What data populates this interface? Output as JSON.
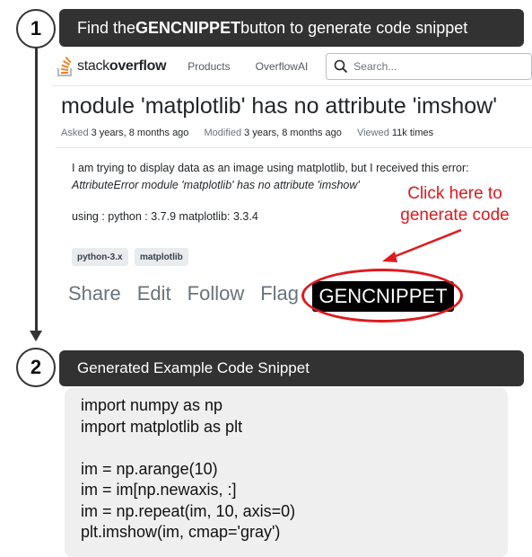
{
  "steps": {
    "one": "1",
    "two": "2"
  },
  "banner1": {
    "prefix": "Find the ",
    "bold": "GENCNIPPET",
    "suffix": " button to generate code snippet"
  },
  "banner2": {
    "title": "Generated Example Code Snippet"
  },
  "header": {
    "logo_light": "stack",
    "logo_bold": "overflow",
    "nav": [
      "Products",
      "OverflowAI"
    ],
    "search_placeholder": "Search..."
  },
  "question": {
    "title": "module 'matplotlib' has no attribute 'imshow'",
    "asked_label": "Asked",
    "asked_value": "3 years, 8 months ago",
    "modified_label": "Modified",
    "modified_value": "3 years, 8 months ago",
    "viewed_label": "Viewed",
    "viewed_value": "11k times",
    "body_line1": "I am trying to display data as an image using matplotlib, but I received this error:",
    "body_line2": "AttributeError module 'matplotlib' has no attribute 'imshow'",
    "body_line3": "using : python : 3.7.9 matplotlib: 3.3.4",
    "tags": [
      "python-3.x",
      "matplotlib"
    ],
    "actions": [
      "Share",
      "Edit",
      "Follow",
      "Flag"
    ],
    "gen_button": "GENCNIPPET"
  },
  "callout": {
    "line1": "Click here to",
    "line2": "generate code",
    "color": "#e0191e"
  },
  "code_lines": [
    "import numpy as np",
    "import matplotlib as plt",
    "",
    "im = np.arange(10)",
    "im = im[np.newaxis, :]",
    "im = np.repeat(im, 10, axis=0)",
    "plt.imshow(im, cmap='gray')"
  ],
  "icons": [
    "stackoverflow-logo-icon",
    "search-icon"
  ]
}
